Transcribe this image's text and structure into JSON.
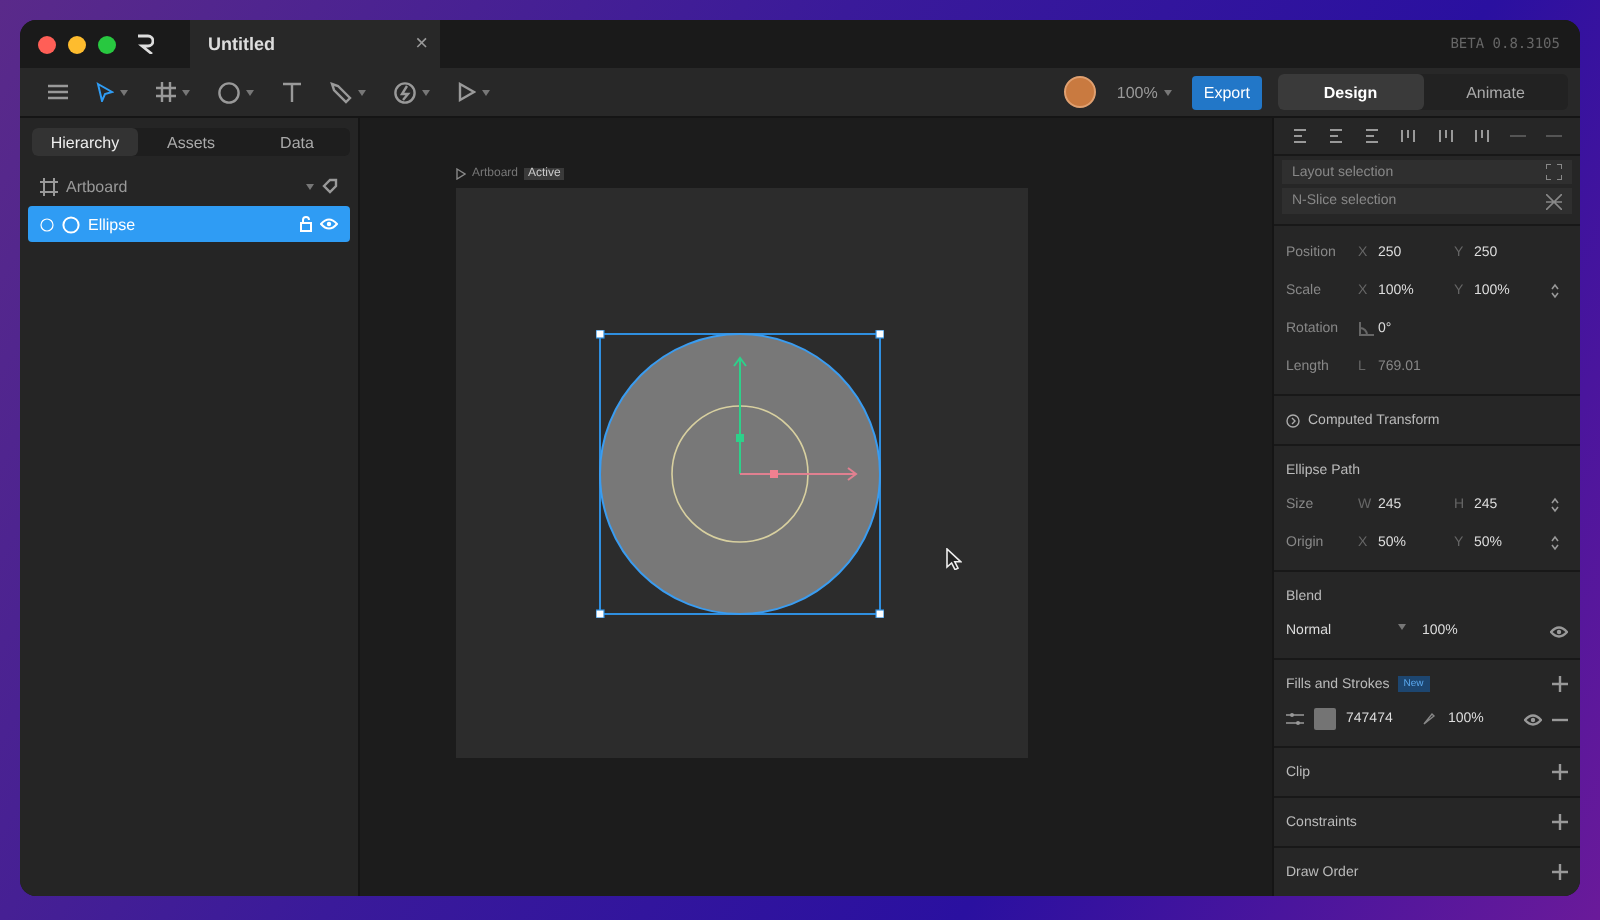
{
  "window": {
    "tab_title": "Untitled",
    "close_glyph": "×",
    "version": "BETA 0.8.3105"
  },
  "toolbar": {
    "zoom": "100%",
    "export": "Export",
    "modes": [
      {
        "label": "Design",
        "selected": true
      },
      {
        "label": "Animate",
        "selected": false
      }
    ]
  },
  "left_tabs": [
    {
      "label": "Hierarchy",
      "selected": true
    },
    {
      "label": "Assets",
      "selected": false
    },
    {
      "label": "Data",
      "selected": false
    }
  ],
  "hierarchy": [
    {
      "label": "Artboard",
      "kind": "artboard",
      "selected": false
    },
    {
      "label": "Ellipse",
      "kind": "ellipse",
      "selected": true
    }
  ],
  "canvas": {
    "artboard_label": "Artboard",
    "artboard_badge": "Active"
  },
  "inspector": {
    "layout_selection": "Layout selection",
    "nslice_selection": "N-Slice selection",
    "transform_rows": [
      {
        "label": "Position",
        "kind": "xy",
        "fields": [
          {
            "axis": "X",
            "value": "250"
          },
          {
            "axis": "Y",
            "value": "250"
          }
        ],
        "stepper": false
      },
      {
        "label": "Scale",
        "kind": "xy",
        "fields": [
          {
            "axis": "X",
            "value": "100%"
          },
          {
            "axis": "Y",
            "value": "100%"
          }
        ],
        "stepper": true
      },
      {
        "label": "Rotation",
        "kind": "angle",
        "fields": [
          {
            "value": "0°"
          }
        ],
        "stepper": false
      },
      {
        "label": "Length",
        "kind": "length",
        "fields": [
          {
            "axis": "L",
            "value": "769.01"
          }
        ],
        "stepper": false
      }
    ],
    "computed_transform": "Computed Transform",
    "ellipse_path": {
      "title": "Ellipse Path",
      "rows": [
        {
          "label": "Size",
          "fields": [
            {
              "axis": "W",
              "value": "245"
            },
            {
              "axis": "H",
              "value": "245"
            }
          ]
        },
        {
          "label": "Origin",
          "fields": [
            {
              "axis": "X",
              "value": "50%"
            },
            {
              "axis": "Y",
              "value": "50%"
            }
          ]
        }
      ]
    },
    "blend": {
      "title": "Blend",
      "mode": "Normal",
      "opacity": "100%"
    },
    "fills": {
      "title": "Fills and Strokes",
      "badge": "New",
      "items": [
        {
          "hex": "747474",
          "color": "#747474",
          "opacity": "100%"
        }
      ]
    },
    "sections": [
      "Clip",
      "Constraints",
      "Draw Order"
    ]
  }
}
